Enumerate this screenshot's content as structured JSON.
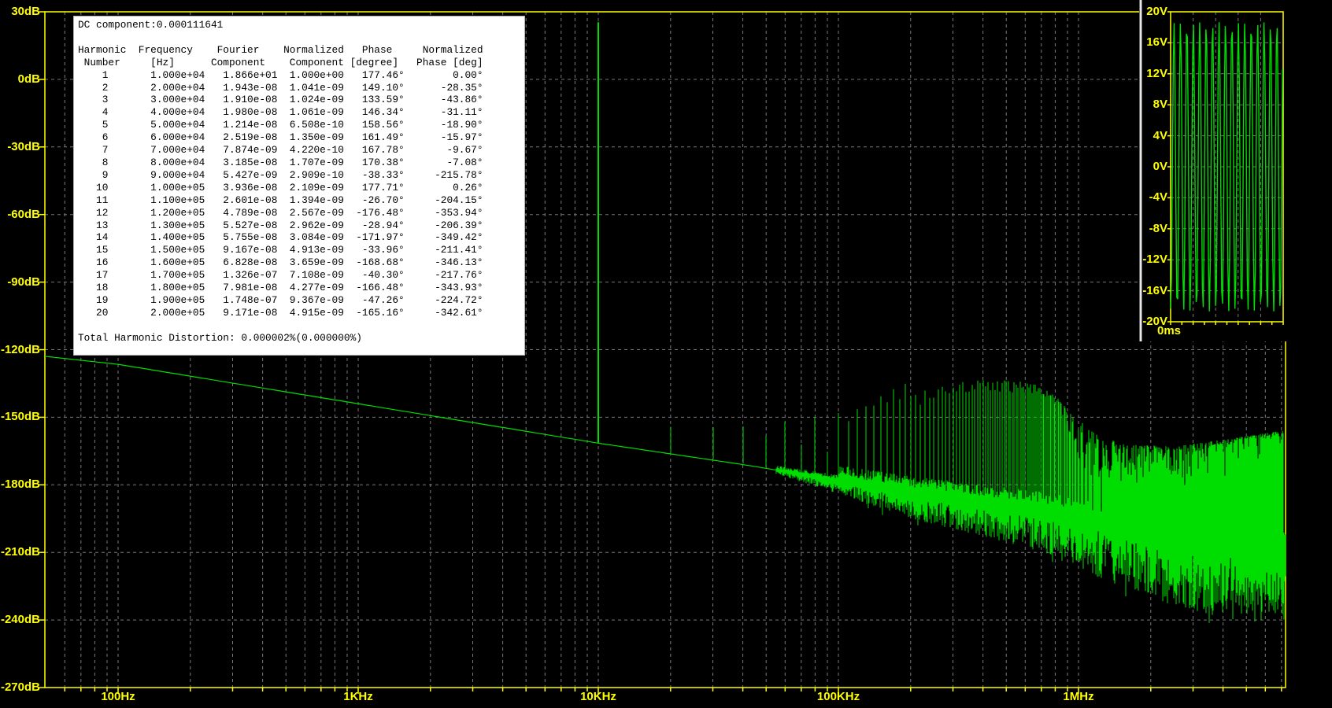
{
  "colors": {
    "background": "#000000",
    "axis": "#ffff00",
    "grid": "#787878",
    "trace": "#00dd00",
    "table_bg": "#ffffff",
    "table_text": "#000000",
    "pane_divider_light": "#e8e8e8",
    "pane_divider_dark": "#6f6f6f"
  },
  "chart_data": [
    {
      "type": "line",
      "name": "fft-spectrum",
      "x_axis": {
        "scale": "log",
        "unit": "Hz",
        "tick_labels": [
          "100Hz",
          "1KHz",
          "10KHz",
          "100KHz",
          "1MHz"
        ],
        "tick_freqs": [
          100,
          1000,
          10000,
          100000,
          1000000
        ],
        "range_hz": [
          49.5,
          7150000
        ],
        "grid": true
      },
      "y_axis": {
        "unit": "dB",
        "tick_labels": [
          "30dB",
          "0dB",
          "-30dB",
          "-60dB",
          "-90dB",
          "-120dB",
          "-150dB",
          "-180dB",
          "-210dB",
          "-240dB",
          "-270dB"
        ],
        "tick_values": [
          30,
          0,
          -30,
          -60,
          -90,
          -120,
          -150,
          -180,
          -210,
          -240,
          -270
        ],
        "range_db": [
          -270,
          30
        ],
        "grid": true
      },
      "fundamental": {
        "freq_hz": 10000,
        "peak_db": 25.4
      },
      "harmonic_spacing_hz": 10000,
      "baseline_db": [
        [
          50,
          -123
        ],
        [
          100,
          -126.5
        ],
        [
          1000,
          -144
        ],
        [
          10000,
          -161.5
        ],
        [
          40000,
          -171
        ],
        [
          100000,
          -178
        ],
        [
          200000,
          -183
        ],
        [
          400000,
          -187
        ],
        [
          700000,
          -190
        ],
        [
          1000000,
          -193
        ],
        [
          1500000,
          -198
        ],
        [
          2500000,
          -202
        ],
        [
          4000000,
          -205
        ],
        [
          7000000,
          -207
        ]
      ],
      "spike_envelope_db": [
        [
          110000,
          -152
        ],
        [
          200000,
          -140.8
        ],
        [
          250000,
          -136
        ],
        [
          300000,
          -134
        ],
        [
          500000,
          -133
        ],
        [
          700000,
          -136
        ],
        [
          850000,
          -143
        ],
        [
          1000000,
          -151
        ],
        [
          1200000,
          -158
        ],
        [
          1600000,
          -162
        ],
        [
          2500000,
          -163
        ],
        [
          4000000,
          -160
        ],
        [
          7000000,
          -156
        ]
      ],
      "noise_depth_db": [
        [
          50000,
          1
        ],
        [
          100000,
          6
        ],
        [
          200000,
          12
        ],
        [
          400000,
          16
        ],
        [
          700000,
          20
        ],
        [
          1000000,
          24
        ],
        [
          1500000,
          28
        ],
        [
          2500000,
          32
        ],
        [
          4000000,
          34
        ],
        [
          7000000,
          36
        ]
      ]
    },
    {
      "type": "line",
      "name": "time-domain-inset",
      "y_axis": {
        "unit": "V",
        "tick_labels": [
          "20V",
          "16V",
          "12V",
          "8V",
          "4V",
          "0V",
          "-4V",
          "-8V",
          "-12V",
          "-16V",
          "-20V"
        ],
        "tick_values": [
          20,
          16,
          12,
          8,
          4,
          0,
          -4,
          -8,
          -12,
          -16,
          -20
        ],
        "range_v": [
          -20,
          20
        ],
        "grid": true
      },
      "x_axis": {
        "label": "0ms"
      },
      "amplitude_v": 18.66,
      "cycles_shown": 17.5
    }
  ],
  "fourier_analysis": {
    "dc_component_line": "DC component:0.000111641",
    "header_line1": "Harmonic  Frequency    Fourier    Normalized   Phase     Normalized",
    "header_line2": " Number     [Hz]      Component    Component [degree]   Phase [deg]",
    "rows": [
      [
        "1",
        "1.000e+04",
        "1.866e+01",
        "1.000e+00",
        "177.46°",
        "0.00°"
      ],
      [
        "2",
        "2.000e+04",
        "1.943e-08",
        "1.041e-09",
        "149.10°",
        "-28.35°"
      ],
      [
        "3",
        "3.000e+04",
        "1.910e-08",
        "1.024e-09",
        "133.59°",
        "-43.86°"
      ],
      [
        "4",
        "4.000e+04",
        "1.980e-08",
        "1.061e-09",
        "146.34°",
        "-31.11°"
      ],
      [
        "5",
        "5.000e+04",
        "1.214e-08",
        "6.508e-10",
        "158.56°",
        "-18.90°"
      ],
      [
        "6",
        "6.000e+04",
        "2.519e-08",
        "1.350e-09",
        "161.49°",
        "-15.97°"
      ],
      [
        "7",
        "7.000e+04",
        "7.874e-09",
        "4.220e-10",
        "167.78°",
        "-9.67°"
      ],
      [
        "8",
        "8.000e+04",
        "3.185e-08",
        "1.707e-09",
        "170.38°",
        "-7.08°"
      ],
      [
        "9",
        "9.000e+04",
        "5.427e-09",
        "2.909e-10",
        "-38.33°",
        "-215.78°"
      ],
      [
        "10",
        "1.000e+05",
        "3.936e-08",
        "2.109e-09",
        "177.71°",
        "0.26°"
      ],
      [
        "11",
        "1.100e+05",
        "2.601e-08",
        "1.394e-09",
        "-26.70°",
        "-204.15°"
      ],
      [
        "12",
        "1.200e+05",
        "4.789e-08",
        "2.567e-09",
        "-176.48°",
        "-353.94°"
      ],
      [
        "13",
        "1.300e+05",
        "5.527e-08",
        "2.962e-09",
        "-28.94°",
        "-206.39°"
      ],
      [
        "14",
        "1.400e+05",
        "5.755e-08",
        "3.084e-09",
        "-171.97°",
        "-349.42°"
      ],
      [
        "15",
        "1.500e+05",
        "9.167e-08",
        "4.913e-09",
        "-33.96°",
        "-211.41°"
      ],
      [
        "16",
        "1.600e+05",
        "6.828e-08",
        "3.659e-09",
        "-168.68°",
        "-346.13°"
      ],
      [
        "17",
        "1.700e+05",
        "1.326e-07",
        "7.108e-09",
        "-40.30°",
        "-217.76°"
      ],
      [
        "18",
        "1.800e+05",
        "7.981e-08",
        "4.277e-09",
        "-166.48°",
        "-343.93°"
      ],
      [
        "19",
        "1.900e+05",
        "1.748e-07",
        "9.367e-09",
        "-47.26°",
        "-224.72°"
      ],
      [
        "20",
        "2.000e+05",
        "9.171e-08",
        "4.915e-09",
        "-165.16°",
        "-342.61°"
      ]
    ],
    "thd_line": "Total Harmonic Distortion: 0.000002%(0.000000%)"
  }
}
